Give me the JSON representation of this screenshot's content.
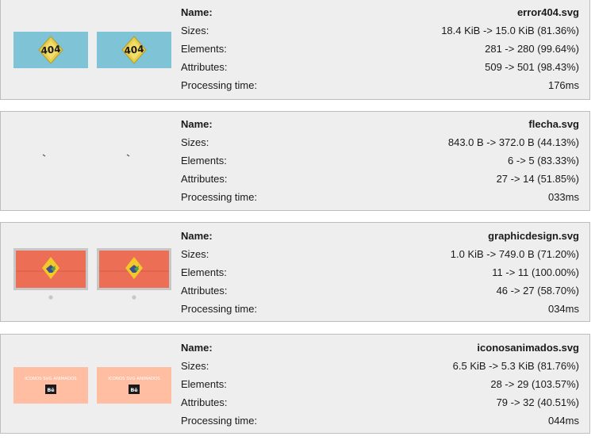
{
  "labels": {
    "name": "Name:",
    "sizes": "Sizes:",
    "elements": "Elements:",
    "attributes": "Attributes:",
    "processing_time": "Processing time:"
  },
  "results": [
    {
      "name": "error404.svg",
      "sizes": "18.4 KiB -> 15.0 KiB (81.36%)",
      "elements": "281 -> 280 (99.64%)",
      "attributes": "509 -> 501 (98.43%)",
      "processing_time": "176ms",
      "thumbnail": {
        "icon": "error-404-graphic",
        "caption": "404",
        "bg_color": "#7ec3d6"
      }
    },
    {
      "name": "flecha.svg",
      "sizes": "843.0 B -> 372.0 B (44.13%)",
      "elements": "6 -> 5 (83.33%)",
      "attributes": "27 -> 14 (51.85%)",
      "processing_time": "033ms",
      "thumbnail": {
        "icon": "arrow-graphic"
      }
    },
    {
      "name": "graphicdesign.svg",
      "sizes": "1.0 KiB -> 749.0 B (71.20%)",
      "elements": "11 -> 11 (100.00%)",
      "attributes": "46 -> 27 (58.70%)",
      "processing_time": "034ms",
      "thumbnail": {
        "icon": "monitor-graphic",
        "bg_color": "#ec6e55"
      }
    },
    {
      "name": "iconosanimados.svg",
      "sizes": "6.5 KiB -> 5.3 KiB (81.76%)",
      "elements": "28 -> 29 (103.57%)",
      "attributes": "79 -> 32 (40.51%)",
      "processing_time": "044ms",
      "thumbnail": {
        "icon": "behance-banner-graphic",
        "caption": "ICONOS SVG ANIMADOS",
        "badge": "Bē",
        "bg_color": "#ffbea1"
      }
    }
  ]
}
